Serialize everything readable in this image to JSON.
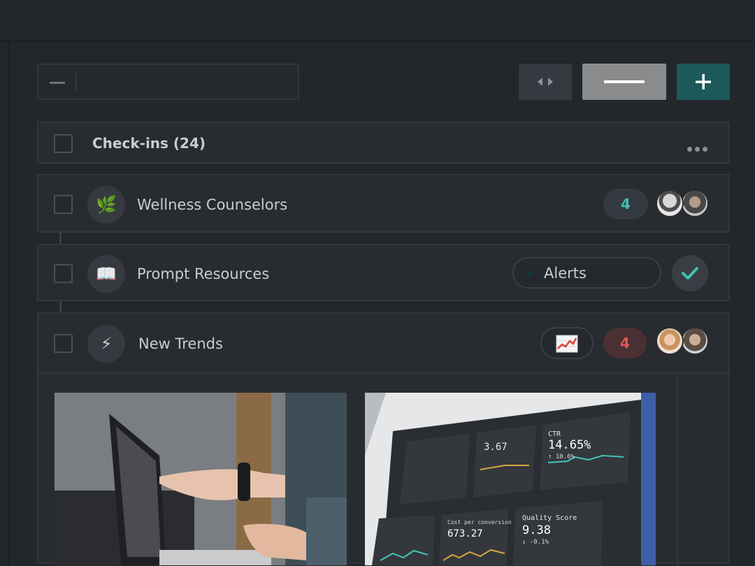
{
  "toolbar": {
    "search_value": "",
    "collapse_label": "collapse-all",
    "add_label": "add"
  },
  "list": {
    "title": "Check-ins (24)",
    "rows": [
      {
        "label": "Wellness Counselors",
        "icon": "leaf-icon",
        "icon_glyph": "🌿",
        "count": "4",
        "count_color": "#3fc1b4"
      },
      {
        "label": "Prompt Resources",
        "icon": "book-icon",
        "icon_glyph": "📖",
        "tag": "Alerts"
      },
      {
        "label": "New Trends",
        "icon": "lightning-icon",
        "icon_glyph": "⚡",
        "count": "4",
        "count_color": "#e05b55"
      }
    ]
  },
  "images": [
    {
      "subject": "laptop-photo"
    },
    {
      "subject": "dashboard-photo",
      "screen_texts": [
        "CTR",
        "14.65%",
        "↑ 10.6%",
        "3.67",
        "Quality Score",
        "9.38",
        "↓ -0.1%",
        "Cost per conversion",
        "673.27"
      ]
    }
  ],
  "colors": {
    "background": "#23262b",
    "panel": "#282b30",
    "accent_teal": "#1c5a5c",
    "badge_teal": "#3fc1b4",
    "badge_red": "#e05b55"
  }
}
